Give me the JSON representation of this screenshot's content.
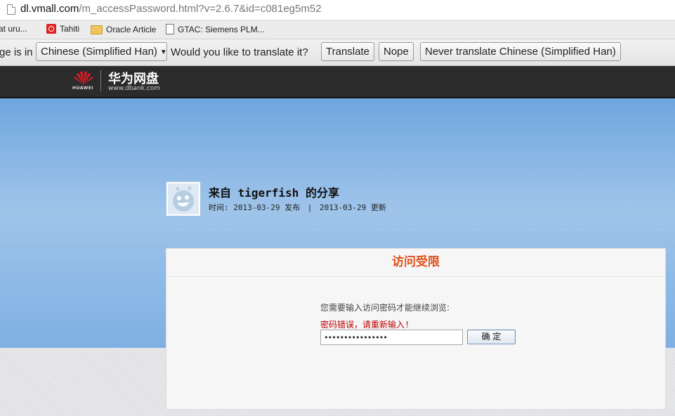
{
  "browser": {
    "url_host": "dl.vmall.com",
    "url_path": "/m_accessPassword.html?v=2.6.7&id=c081eg5m52"
  },
  "bookmarks": [
    {
      "label": "at  uru...",
      "icon": "page-icon"
    },
    {
      "label": "Tahiti",
      "icon": "search-favicon"
    },
    {
      "label": "Oracle Article",
      "icon": "folder-icon"
    },
    {
      "label": "GTAC: Siemens PLM...",
      "icon": "page-icon"
    }
  ],
  "translate_bar": {
    "prefix": "ge is in",
    "language": "Chinese (Simplified Han)",
    "question": "Would you like to translate it?",
    "translate_label": "Translate",
    "nope_label": "Nope",
    "never_label": "Never translate Chinese (Simplified Han)"
  },
  "header": {
    "logo_text": "HUAWEI",
    "brand_name": "华为网盘",
    "brand_url": "www.dbank.com"
  },
  "share": {
    "title": "来自 tigerfish 的分享",
    "time_label": "时间:",
    "published": "2013-03-29 发布",
    "updated": "2013-03-29 更新"
  },
  "access_panel": {
    "title": "访问受限",
    "prompt": "您需要输入访问密码才能继续浏览:",
    "error": "密码错误，请重新输入!",
    "password_value": "••••••••••••••••",
    "confirm_label": "确 定"
  },
  "colors": {
    "accent_title": "#e0501a",
    "error": "#c00000",
    "header_bg": "#2b2b2b",
    "brand_red": "#d21f26"
  }
}
